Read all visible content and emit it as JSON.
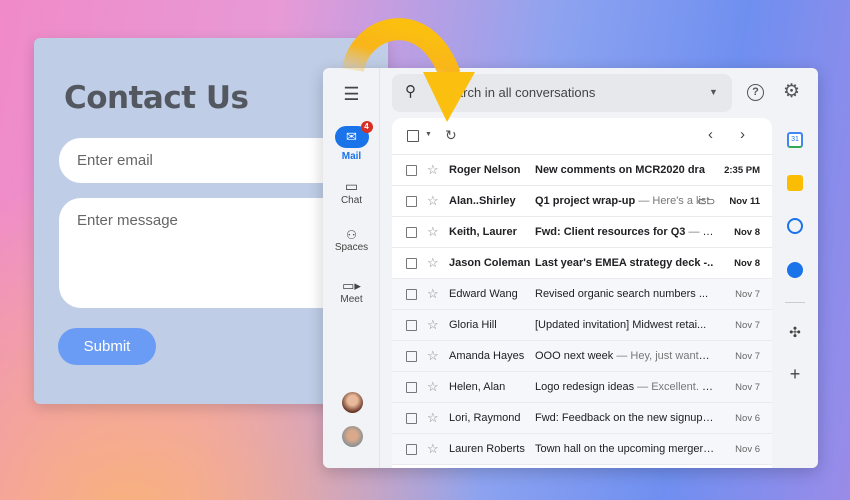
{
  "contact": {
    "title": "Contact Us",
    "email_placeholder": "Enter email",
    "message_placeholder": "Enter message",
    "submit": "Submit"
  },
  "gmail": {
    "nav": [
      {
        "label": "Mail",
        "badge": "4",
        "icon": "mail-icon"
      },
      {
        "label": "Chat",
        "icon": "chat-icon"
      },
      {
        "label": "Spaces",
        "icon": "spaces-icon"
      },
      {
        "label": "Meet",
        "icon": "meet-icon"
      }
    ],
    "search_placeholder": "Search in all conversations",
    "accent": "#1a73e8",
    "emails": [
      {
        "sender": "Roger Nelson",
        "subject": "New comments on MCR2020 dra",
        "snippet": "",
        "date": "2:35 PM",
        "unread": true
      },
      {
        "sender": "Alan..Shirley",
        "subject": "Q1 project wrap-up",
        "snippet": "— Here's a list",
        "date": "Nov 11",
        "unread": true,
        "attachment": true
      },
      {
        "sender": "Keith, Laurer",
        "subject": "Fwd: Client resources for Q3",
        "snippet": "— R...",
        "date": "Nov 8",
        "unread": true
      },
      {
        "sender": "Jason Coleman",
        "subject": "Last year's EMEA strategy deck -..",
        "snippet": "",
        "date": "Nov 8",
        "unread": true
      },
      {
        "sender": "Edward Wang",
        "subject": "Revised organic search numbers ...",
        "snippet": "",
        "date": "Nov 7",
        "unread": false
      },
      {
        "sender": "Gloria Hill",
        "subject": "[Updated invitation] Midwest retai...",
        "snippet": "",
        "date": "Nov 7",
        "unread": false
      },
      {
        "sender": "Amanda Hayes",
        "subject": "OOO next week",
        "snippet": "— Hey, just wanted ...",
        "date": "Nov 7",
        "unread": false
      },
      {
        "sender": "Helen, Alan",
        "subject": "Logo redesign ideas",
        "snippet": "— Excellent. hi...",
        "date": "Nov 7",
        "unread": false
      },
      {
        "sender": "Lori, Raymond",
        "subject": "Fwd: Feedback on the new signup e...",
        "snippet": "",
        "date": "Nov 6",
        "unread": false
      },
      {
        "sender": "Lauren Roberts",
        "subject": "Town hall on the upcoming merger ...",
        "snippet": "",
        "date": "Nov 6",
        "unread": false
      }
    ],
    "right_apps": [
      "calendar-icon",
      "keep-icon",
      "tasks-icon",
      "contacts-icon",
      "addons-icon",
      "add-icon"
    ]
  }
}
